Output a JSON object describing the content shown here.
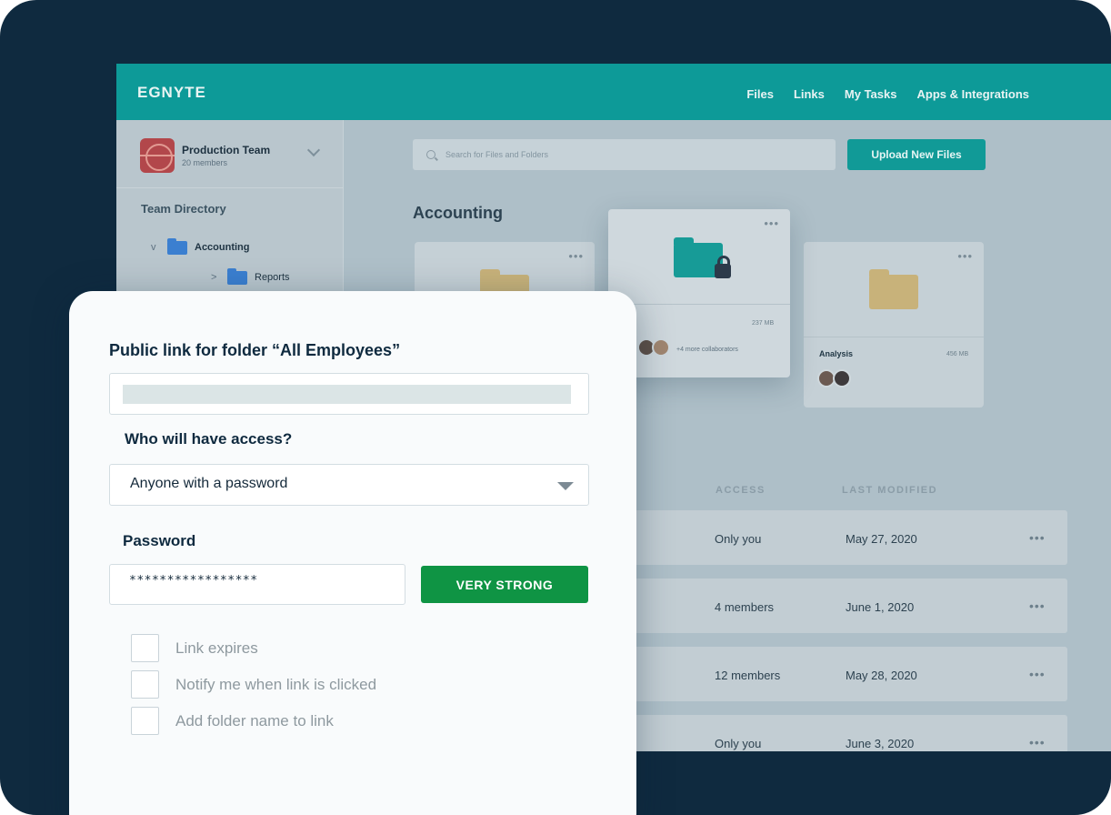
{
  "app": {
    "logo": "EGNYTE",
    "nav": [
      "Files",
      "Links",
      "My Tasks",
      "Apps & Integrations"
    ]
  },
  "sidebar": {
    "team_name": "Production Team",
    "team_members": "20 members",
    "directory_title": "Team Directory",
    "tree": [
      {
        "label": "Accounting",
        "caret": "v"
      },
      {
        "label": "Reports",
        "caret": ">"
      }
    ]
  },
  "main": {
    "search_placeholder": "Search for Files and Folders",
    "upload_label": "Upload New Files",
    "section_title": "Accounting",
    "cards": [
      {
        "dots": "•••"
      },
      {
        "dots": "•••",
        "size": "237 MB",
        "collaborators": "+4 more collaborators"
      },
      {
        "dots": "•••",
        "name": "Analysis",
        "size": "456 MB"
      }
    ],
    "columns": {
      "access": "ACCESS",
      "last_modified": "LAST MODIFIED"
    },
    "rows": [
      {
        "access": "Only you",
        "date": "May 27, 2020",
        "dots": "•••"
      },
      {
        "access": "4 members",
        "date": "June 1, 2020",
        "dots": "•••"
      },
      {
        "access": "12 members",
        "date": "May 28, 2020",
        "dots": "•••"
      },
      {
        "access": "Only you",
        "date": "June 3, 2020",
        "dots": "•••"
      }
    ]
  },
  "modal": {
    "title": "Public link for folder “All Employees”",
    "access_label": "Who will have access?",
    "access_value": "Anyone with a password",
    "password_label": "Password",
    "password_value": "*****************",
    "strength_label": "VERY STRONG",
    "options": [
      {
        "label": "Link expires",
        "checked": false
      },
      {
        "label": "Notify me when link is clicked",
        "checked": false
      },
      {
        "label": "Add folder name to link",
        "checked": false
      }
    ]
  },
  "colors": {
    "frame": "#0f2a3f",
    "header_teal": "#0d9a98",
    "strength_green": "#0f9444",
    "accent_teal": "#119a97"
  }
}
